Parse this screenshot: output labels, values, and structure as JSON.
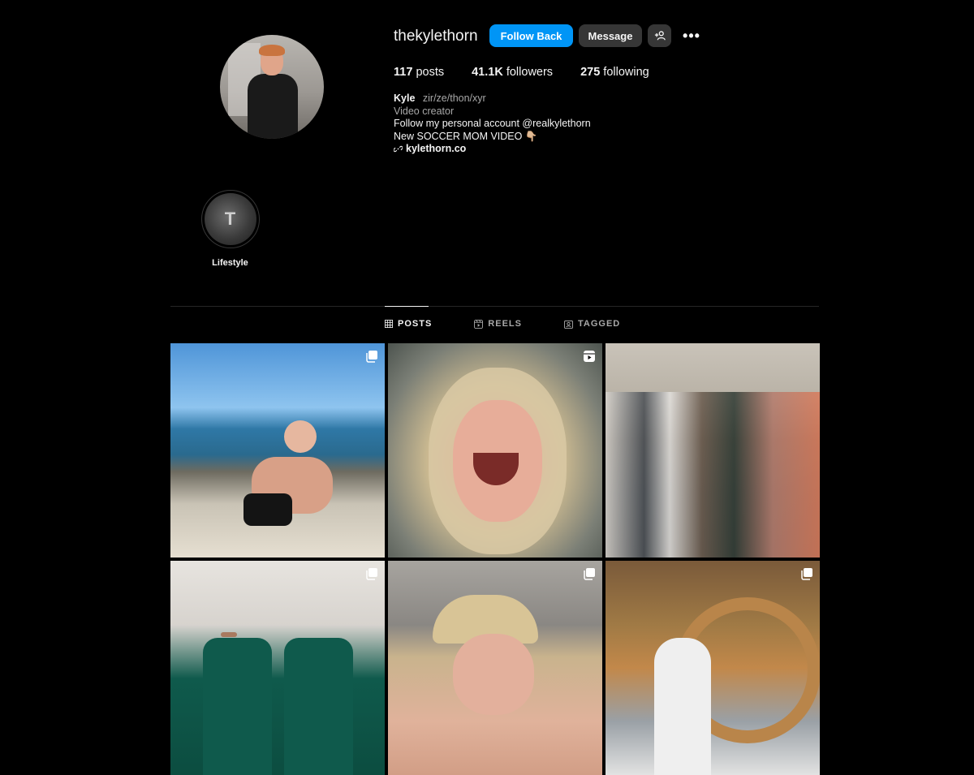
{
  "profile": {
    "username": "thekylethorn",
    "follow_back_label": "Follow Back",
    "message_label": "Message",
    "more_label": "•••",
    "stats": {
      "posts_count": "117",
      "posts_label": "posts",
      "followers_count": "41.1K",
      "followers_label": "followers",
      "following_count": "275",
      "following_label": "following"
    },
    "bio": {
      "name": "Kyle",
      "pronouns": "zir/ze/thon/xyr",
      "category": "Video creator",
      "line1": "Follow my personal account @realkylethorn",
      "line2": "New SOCCER MOM VIDEO 👇🏼",
      "link": "kylethorn.co"
    }
  },
  "highlights": [
    {
      "label": "Lifestyle",
      "icon": "T"
    }
  ],
  "tabs": [
    {
      "label": "POSTS",
      "icon": "grid-icon",
      "active": true
    },
    {
      "label": "REELS",
      "icon": "reels-icon",
      "active": false
    },
    {
      "label": "TAGGED",
      "icon": "tagged-icon",
      "active": false
    }
  ],
  "posts": [
    {
      "type": "carousel"
    },
    {
      "type": "reel"
    },
    {
      "type": "photo"
    },
    {
      "type": "carousel"
    },
    {
      "type": "carousel"
    },
    {
      "type": "carousel"
    }
  ],
  "colors": {
    "background": "#000000",
    "primary_button": "#0095f6",
    "secondary_button": "#363636",
    "muted_text": "#a8a8a8",
    "divider": "#262626"
  }
}
